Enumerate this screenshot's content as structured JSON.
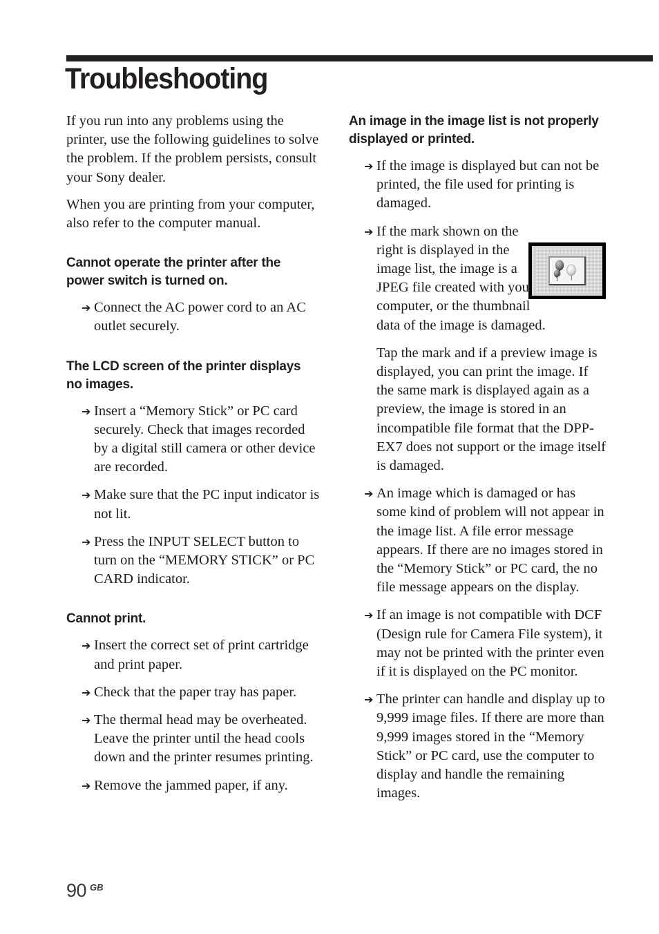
{
  "page": {
    "title": "Troubleshooting",
    "number": "90",
    "region": "GB"
  },
  "left_column": {
    "intro": [
      "If you run into any problems using the printer, use the following guidelines to solve the problem. If the problem persists, consult your Sony dealer.",
      "When you are printing from your computer, also refer to the computer manual."
    ],
    "sections": [
      {
        "heading": "Cannot operate the printer after the power switch is turned on.",
        "items": [
          "Connect the AC power cord to an AC outlet securely."
        ]
      },
      {
        "heading": "The LCD screen of the printer displays no images.",
        "items": [
          "Insert a “Memory Stick” or PC card securely. Check that images recorded by a digital still camera or other device are recorded.",
          "Make sure that the PC input indicator is not lit.",
          "Press the INPUT SELECT button to turn on the “MEMORY STICK” or PC CARD indicator."
        ]
      },
      {
        "heading": "Cannot print.",
        "items": [
          "Insert the correct set of print cartridge and print paper.",
          "Check that the paper tray has paper.",
          "The thermal head may be overheated.  Leave the printer until the head cools down and the printer resumes printing.",
          "Remove the jammed paper, if any."
        ]
      }
    ]
  },
  "right_column": {
    "heading": "An image in the image list is not properly displayed or printed.",
    "items": [
      "If the image is displayed but can not be printed, the file used for printing is damaged.",
      "If the mark shown on the right is displayed in the image list, the image is a JPEG file created with your computer, or the thumbnail data of the image is damaged.",
      "An image which is damaged or has some kind of problem will not appear in the image list.  A file error message appears.  If there are no images stored in the “Memory Stick” or PC card, the no file message appears on the display.",
      "If an image is not compatible with DCF (Design rule for Camera File system), it may not be printed with the printer even if it is displayed on the PC monitor.",
      "The printer can handle and display up to 9,999 image files.  If there are more than 9,999 images stored in the “Memory Stick” or PC card, use the computer to display and handle the remaining images."
    ],
    "continuation": "Tap the mark and if a preview image is displayed, you can print the image. If the same mark is displayed again as a preview, the image is stored in an incompatible file format that the DPP-EX7 does not support or the image itself is damaged."
  },
  "symbols": {
    "arrow": "➔"
  },
  "colors": {
    "rule": "#231f20",
    "text": "#1d1d1d",
    "mark_border": "#000000"
  }
}
